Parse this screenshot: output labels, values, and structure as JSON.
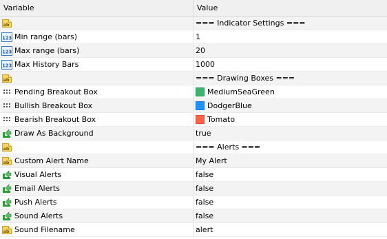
{
  "header": {
    "variable_label": "Variable",
    "value_label": "Value"
  },
  "rows": [
    {
      "type": "string",
      "icon": "string-ab-icon",
      "name": "",
      "value": "=== Indicator Settings ==="
    },
    {
      "type": "int",
      "icon": "integer-123-icon",
      "name": "Min range (bars)",
      "value": "1"
    },
    {
      "type": "int",
      "icon": "integer-123-icon",
      "name": "Max range (bars)",
      "value": "20"
    },
    {
      "type": "int",
      "icon": "integer-123-icon",
      "name": "Max History Bars",
      "value": "1000"
    },
    {
      "type": "string",
      "icon": "string-ab-icon",
      "name": "",
      "value": "=== Drawing Boxes ==="
    },
    {
      "type": "color",
      "icon": "color-grid-icon",
      "name": "Pending Breakout Box",
      "value": "MediumSeaGreen",
      "color": "#3cb371"
    },
    {
      "type": "color",
      "icon": "color-grid-icon",
      "name": "Bullish Breakout Box",
      "value": "DodgerBlue",
      "color": "#1e90ff"
    },
    {
      "type": "color",
      "icon": "color-grid-icon",
      "name": "Bearish Breakout Box",
      "value": "Tomato",
      "color": "#ff6347"
    },
    {
      "type": "bool",
      "icon": "boolean-arrow-icon",
      "name": "Draw As Background",
      "value": "true"
    },
    {
      "type": "string",
      "icon": "string-ab-icon",
      "name": "",
      "value": "=== Alerts ==="
    },
    {
      "type": "string",
      "icon": "string-ab-icon",
      "name": "Custom Alert Name",
      "value": "My Alert"
    },
    {
      "type": "bool",
      "icon": "boolean-arrow-icon",
      "name": "Visual Alerts",
      "value": "false"
    },
    {
      "type": "bool",
      "icon": "boolean-arrow-icon",
      "name": "Email Alerts",
      "value": "false"
    },
    {
      "type": "bool",
      "icon": "boolean-arrow-icon",
      "name": "Push Alerts",
      "value": "false"
    },
    {
      "type": "bool",
      "icon": "boolean-arrow-icon",
      "name": "Sound Alerts",
      "value": "false"
    },
    {
      "type": "string",
      "icon": "string-ab-icon",
      "name": "Sound Filename",
      "value": "alert"
    }
  ]
}
